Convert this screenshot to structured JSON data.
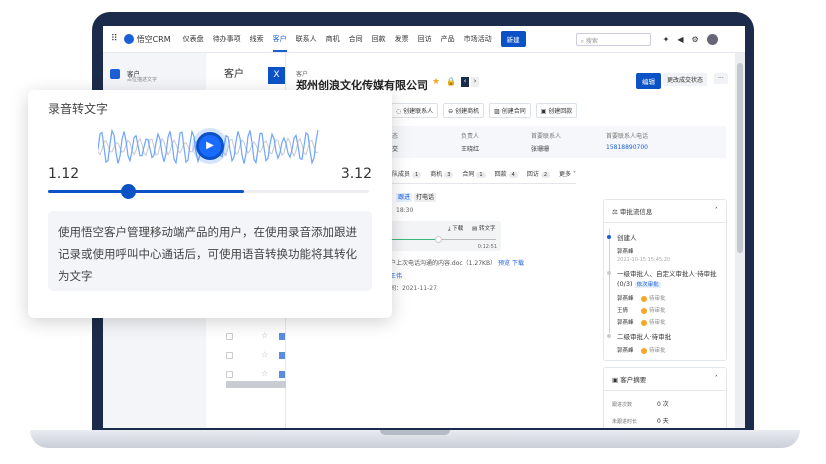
{
  "app": {
    "logo": "悟空CRM",
    "nav": [
      "仪表盘",
      "待办事项",
      "线索",
      "客户",
      "联系人",
      "商机",
      "合同",
      "回款",
      "发票",
      "回访",
      "产品",
      "市场活动"
    ],
    "active_nav": "客户",
    "new_button": "新建",
    "search_placeholder": "搜索"
  },
  "sidebar": {
    "title": "客户",
    "subtitle": "占位描述文字"
  },
  "list": {
    "title": "客户",
    "close": "X"
  },
  "detail": {
    "breadcrumb": "客户",
    "title": "郑州创浪文化传媒有限公司",
    "edit": "编辑",
    "change_status": "更改成交状态",
    "more": "···",
    "actions": [
      "创建联系人",
      "创建商机",
      "创建合同",
      "创建回款"
    ],
    "fields": [
      {
        "label": "状态",
        "value": "成交"
      },
      {
        "label": "负责人",
        "value": "王晓红"
      },
      {
        "label": "首要联系人",
        "value": "张珊珊"
      },
      {
        "label": "首要联系人电话",
        "value": "15818890700"
      }
    ],
    "tabs": [
      {
        "label": "团队成员",
        "count": "1"
      },
      {
        "label": "商机",
        "count": "3"
      },
      {
        "label": "合同",
        "count": "1"
      },
      {
        "label": "回款",
        "count": "4"
      },
      {
        "label": "回访",
        "count": "2"
      },
      {
        "label": "更多",
        "count": ""
      }
    ],
    "tags": [
      "跟进",
      "打电话"
    ],
    "time": "18:30",
    "audio": {
      "download": "下载",
      "to_text": "转文字",
      "duration": "0:12:51",
      "progress": 0.45
    },
    "attachment": "客户上次电话沟通的内容.doc（1.27KB）",
    "preview": "预览",
    "download": "下载",
    "person_label": "：",
    "person": "王伟",
    "date_label": "时间：",
    "date": "2021-11-27"
  },
  "approval": {
    "title": "审批流信息",
    "steps": [
      {
        "title": "创建人",
        "people": [
          {
            "name": "郭燕峰",
            "status": ""
          }
        ],
        "time": "2021-10-15 15:45:20"
      },
      {
        "title": "一级审批人、自定义审批人·待审批(0/3)",
        "badge": "依次审批",
        "people": [
          {
            "name": "郭燕峰",
            "status": "待审批"
          },
          {
            "name": "王倩",
            "status": "待审批"
          },
          {
            "name": "郭燕峰",
            "status": "待审批"
          }
        ]
      },
      {
        "title": "二级审批人·待审批",
        "people": [
          {
            "name": "郭燕峰",
            "status": "待审批"
          }
        ]
      }
    ]
  },
  "summary": {
    "title": "客户摘要",
    "rows": [
      {
        "label": "跟进次数",
        "value": "0 次"
      },
      {
        "label": "未跟进时长",
        "value": "0 天"
      }
    ]
  },
  "popup": {
    "title": "录音转文字",
    "start": "1.12",
    "end": "3.12",
    "progress": 0.61,
    "thumb": 0.25,
    "text": "使用悟空客户管理移动端产品的用户，在使用录音添加跟进记录或使用呼叫中心通话后，可使用语音转换功能将其转化为文字"
  },
  "colors": {
    "accent": "#0b52c6",
    "bezel": "#1c2b4b"
  }
}
